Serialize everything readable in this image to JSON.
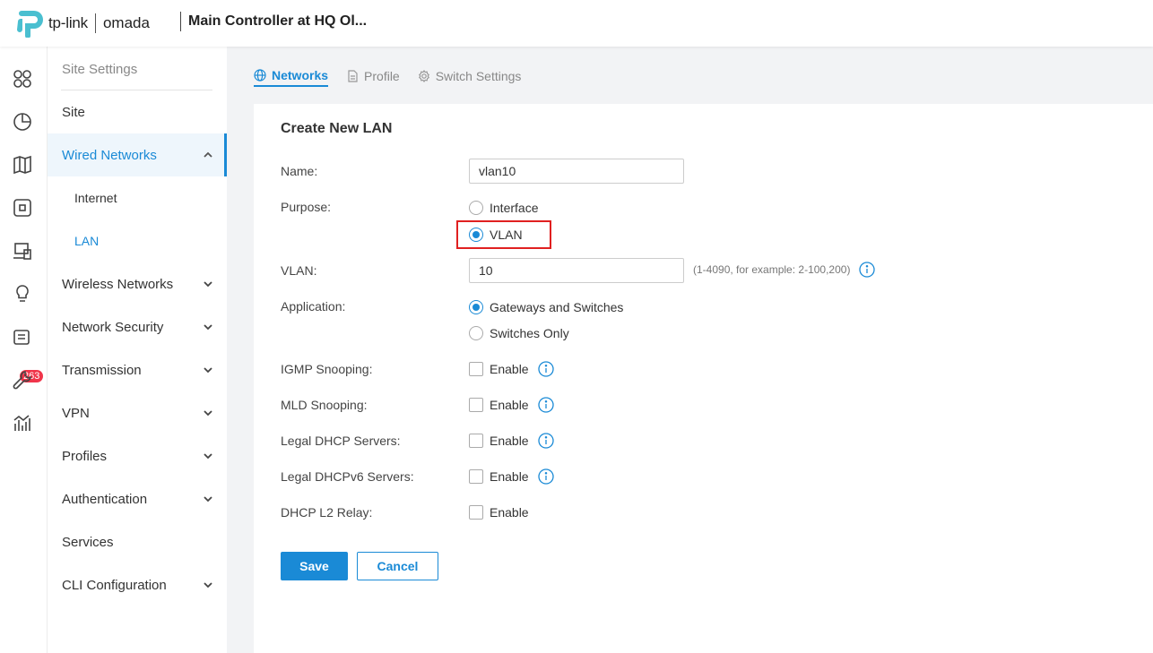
{
  "header": {
    "brand_tplink": "tp-link",
    "brand_omada": "omada",
    "controller_title": "Main Controller at HQ Ol..."
  },
  "rail": {
    "icons": [
      "dashboard-icon",
      "statistics-icon",
      "map-icon",
      "devices-icon",
      "clients-icon",
      "insights-icon",
      "logs-icon",
      "tools-icon",
      "reports-icon"
    ],
    "badge": "263"
  },
  "sidenav": {
    "heading": "Site Settings",
    "items": [
      {
        "label": "Site"
      },
      {
        "label": "Wired Networks"
      },
      {
        "label": "Internet"
      },
      {
        "label": "LAN"
      },
      {
        "label": "Wireless Networks"
      },
      {
        "label": "Network Security"
      },
      {
        "label": "Transmission"
      },
      {
        "label": "VPN"
      },
      {
        "label": "Profiles"
      },
      {
        "label": "Authentication"
      },
      {
        "label": "Services"
      },
      {
        "label": "CLI Configuration"
      }
    ]
  },
  "tabs": [
    {
      "label": "Networks",
      "active": true
    },
    {
      "label": "Profile",
      "active": false
    },
    {
      "label": "Switch Settings",
      "active": false
    }
  ],
  "form": {
    "title": "Create New LAN",
    "name_label": "Name:",
    "name_value": "vlan10",
    "purpose_label": "Purpose:",
    "purpose_options": [
      "Interface",
      "VLAN"
    ],
    "purpose_selected": "VLAN",
    "vlan_label": "VLAN:",
    "vlan_value": "10",
    "vlan_hint": "(1-4090, for example: 2-100,200)",
    "application_label": "Application:",
    "application_options": [
      "Gateways and Switches",
      "Switches Only"
    ],
    "application_selected": "Gateways and Switches",
    "igmp_label": "IGMP Snooping:",
    "mld_label": "MLD Snooping:",
    "dhcp_label": "Legal DHCP Servers:",
    "dhcpv6_label": "Legal DHCPv6 Servers:",
    "relay_label": "DHCP L2 Relay:",
    "enable_label": "Enable",
    "save_label": "Save",
    "cancel_label": "Cancel"
  },
  "colors": {
    "accent": "#1a8ad6",
    "badge": "#f0354a",
    "highlight": "#e02020",
    "brand_teal": "#4abfd0"
  }
}
